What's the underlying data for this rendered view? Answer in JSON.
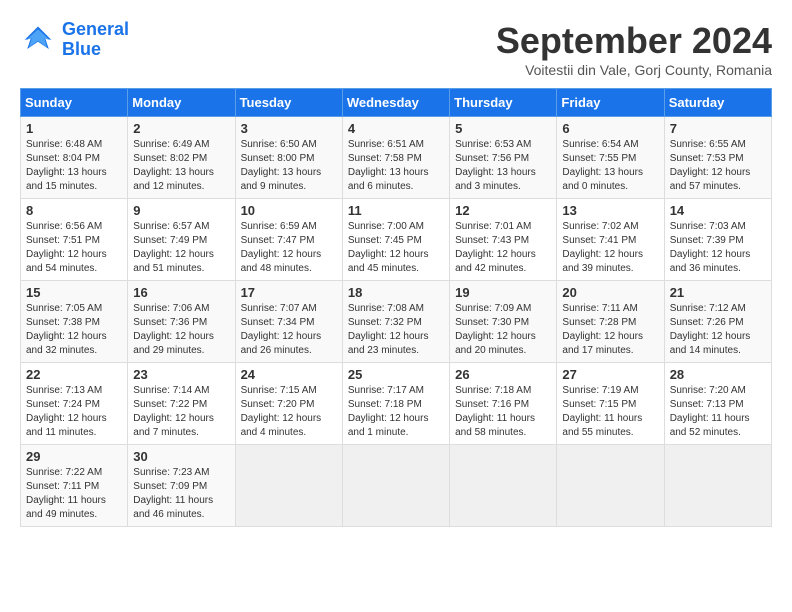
{
  "header": {
    "logo_line1": "General",
    "logo_line2": "Blue",
    "month": "September 2024",
    "location": "Voitestii din Vale, Gorj County, Romania"
  },
  "columns": [
    "Sunday",
    "Monday",
    "Tuesday",
    "Wednesday",
    "Thursday",
    "Friday",
    "Saturday"
  ],
  "weeks": [
    [
      {
        "day": "1",
        "info": "Sunrise: 6:48 AM\nSunset: 8:04 PM\nDaylight: 13 hours\nand 15 minutes."
      },
      {
        "day": "2",
        "info": "Sunrise: 6:49 AM\nSunset: 8:02 PM\nDaylight: 13 hours\nand 12 minutes."
      },
      {
        "day": "3",
        "info": "Sunrise: 6:50 AM\nSunset: 8:00 PM\nDaylight: 13 hours\nand 9 minutes."
      },
      {
        "day": "4",
        "info": "Sunrise: 6:51 AM\nSunset: 7:58 PM\nDaylight: 13 hours\nand 6 minutes."
      },
      {
        "day": "5",
        "info": "Sunrise: 6:53 AM\nSunset: 7:56 PM\nDaylight: 13 hours\nand 3 minutes."
      },
      {
        "day": "6",
        "info": "Sunrise: 6:54 AM\nSunset: 7:55 PM\nDaylight: 13 hours\nand 0 minutes."
      },
      {
        "day": "7",
        "info": "Sunrise: 6:55 AM\nSunset: 7:53 PM\nDaylight: 12 hours\nand 57 minutes."
      }
    ],
    [
      {
        "day": "8",
        "info": "Sunrise: 6:56 AM\nSunset: 7:51 PM\nDaylight: 12 hours\nand 54 minutes."
      },
      {
        "day": "9",
        "info": "Sunrise: 6:57 AM\nSunset: 7:49 PM\nDaylight: 12 hours\nand 51 minutes."
      },
      {
        "day": "10",
        "info": "Sunrise: 6:59 AM\nSunset: 7:47 PM\nDaylight: 12 hours\nand 48 minutes."
      },
      {
        "day": "11",
        "info": "Sunrise: 7:00 AM\nSunset: 7:45 PM\nDaylight: 12 hours\nand 45 minutes."
      },
      {
        "day": "12",
        "info": "Sunrise: 7:01 AM\nSunset: 7:43 PM\nDaylight: 12 hours\nand 42 minutes."
      },
      {
        "day": "13",
        "info": "Sunrise: 7:02 AM\nSunset: 7:41 PM\nDaylight: 12 hours\nand 39 minutes."
      },
      {
        "day": "14",
        "info": "Sunrise: 7:03 AM\nSunset: 7:39 PM\nDaylight: 12 hours\nand 36 minutes."
      }
    ],
    [
      {
        "day": "15",
        "info": "Sunrise: 7:05 AM\nSunset: 7:38 PM\nDaylight: 12 hours\nand 32 minutes."
      },
      {
        "day": "16",
        "info": "Sunrise: 7:06 AM\nSunset: 7:36 PM\nDaylight: 12 hours\nand 29 minutes."
      },
      {
        "day": "17",
        "info": "Sunrise: 7:07 AM\nSunset: 7:34 PM\nDaylight: 12 hours\nand 26 minutes."
      },
      {
        "day": "18",
        "info": "Sunrise: 7:08 AM\nSunset: 7:32 PM\nDaylight: 12 hours\nand 23 minutes."
      },
      {
        "day": "19",
        "info": "Sunrise: 7:09 AM\nSunset: 7:30 PM\nDaylight: 12 hours\nand 20 minutes."
      },
      {
        "day": "20",
        "info": "Sunrise: 7:11 AM\nSunset: 7:28 PM\nDaylight: 12 hours\nand 17 minutes."
      },
      {
        "day": "21",
        "info": "Sunrise: 7:12 AM\nSunset: 7:26 PM\nDaylight: 12 hours\nand 14 minutes."
      }
    ],
    [
      {
        "day": "22",
        "info": "Sunrise: 7:13 AM\nSunset: 7:24 PM\nDaylight: 12 hours\nand 11 minutes."
      },
      {
        "day": "23",
        "info": "Sunrise: 7:14 AM\nSunset: 7:22 PM\nDaylight: 12 hours\nand 7 minutes."
      },
      {
        "day": "24",
        "info": "Sunrise: 7:15 AM\nSunset: 7:20 PM\nDaylight: 12 hours\nand 4 minutes."
      },
      {
        "day": "25",
        "info": "Sunrise: 7:17 AM\nSunset: 7:18 PM\nDaylight: 12 hours\nand 1 minute."
      },
      {
        "day": "26",
        "info": "Sunrise: 7:18 AM\nSunset: 7:16 PM\nDaylight: 11 hours\nand 58 minutes."
      },
      {
        "day": "27",
        "info": "Sunrise: 7:19 AM\nSunset: 7:15 PM\nDaylight: 11 hours\nand 55 minutes."
      },
      {
        "day": "28",
        "info": "Sunrise: 7:20 AM\nSunset: 7:13 PM\nDaylight: 11 hours\nand 52 minutes."
      }
    ],
    [
      {
        "day": "29",
        "info": "Sunrise: 7:22 AM\nSunset: 7:11 PM\nDaylight: 11 hours\nand 49 minutes."
      },
      {
        "day": "30",
        "info": "Sunrise: 7:23 AM\nSunset: 7:09 PM\nDaylight: 11 hours\nand 46 minutes."
      },
      {
        "day": "",
        "info": ""
      },
      {
        "day": "",
        "info": ""
      },
      {
        "day": "",
        "info": ""
      },
      {
        "day": "",
        "info": ""
      },
      {
        "day": "",
        "info": ""
      }
    ]
  ]
}
